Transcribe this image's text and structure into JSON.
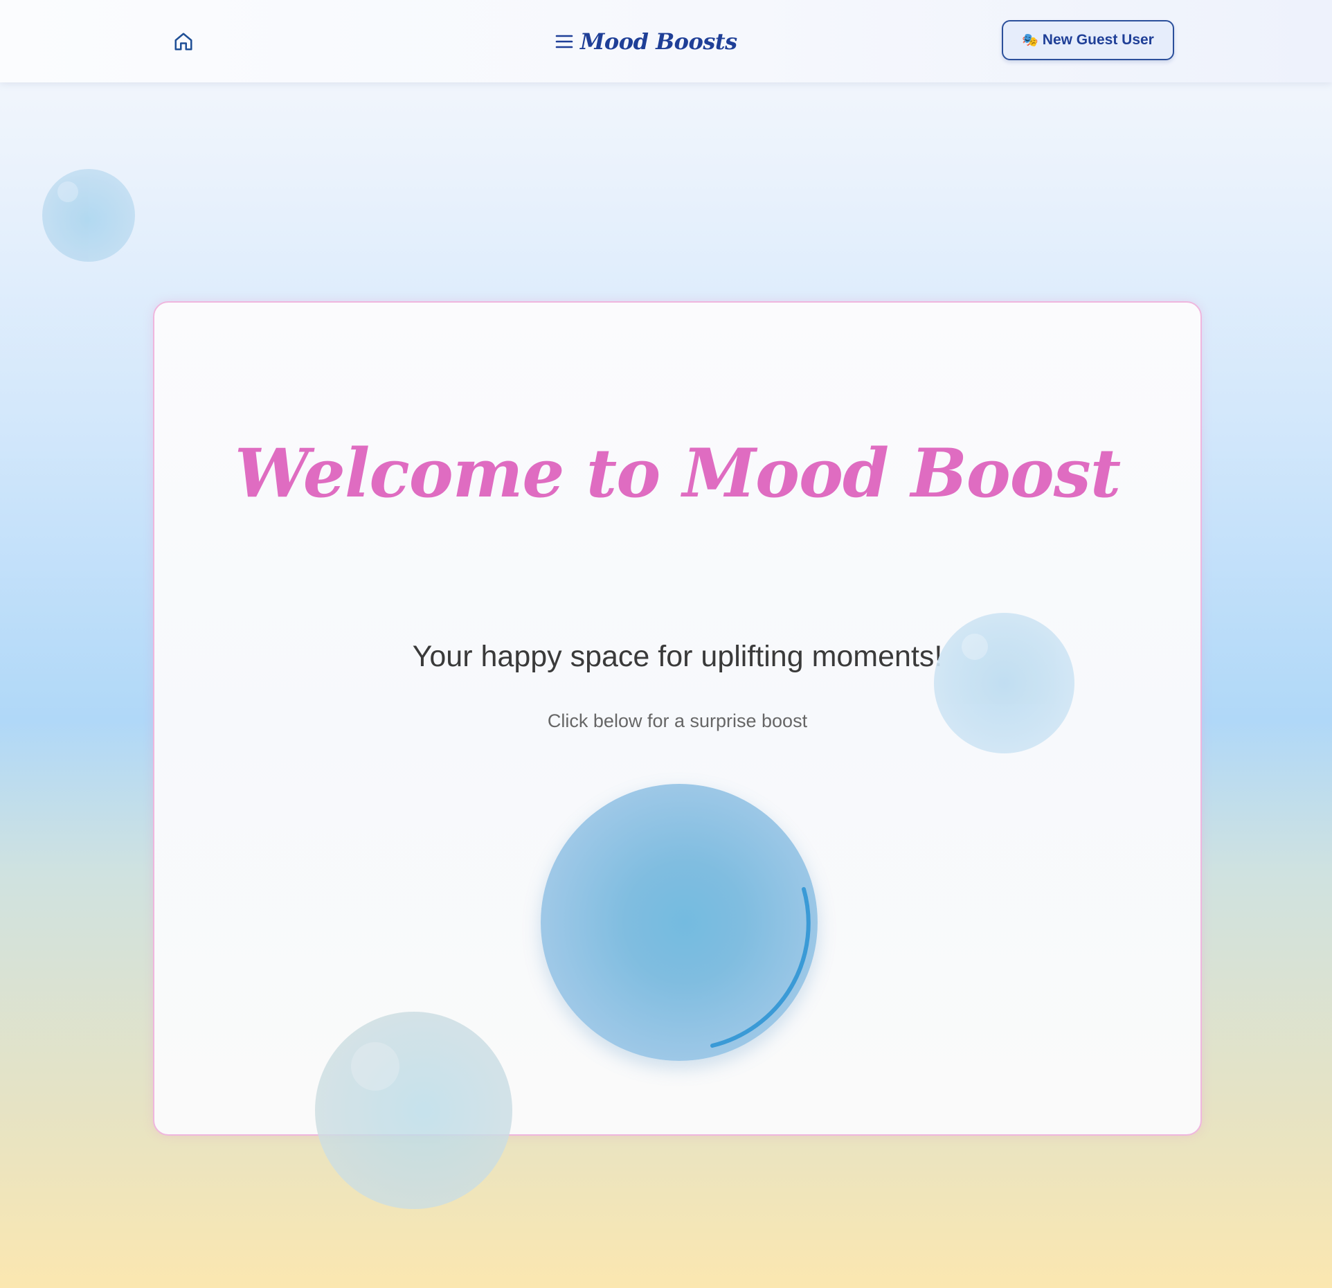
{
  "header": {
    "home_icon": "home-icon",
    "menu_icon": "menu-icon",
    "brand_title": "Mood Boosts",
    "guest_button": {
      "emoji": "🎭",
      "label": "New Guest User"
    }
  },
  "hero": {
    "title": "Welcome to Mood Boost",
    "tagline": "Your happy space for uplifting moments!",
    "prompt": "Click below for a surprise boost",
    "boost_button_icon": "loading-spinner"
  },
  "colors": {
    "brand_blue": "#1f3f97",
    "title_pink": "#df6cc1",
    "card_border": "#efb6de",
    "orb_blue": "#74bbe0",
    "spinner_blue": "#3a9ad6"
  }
}
